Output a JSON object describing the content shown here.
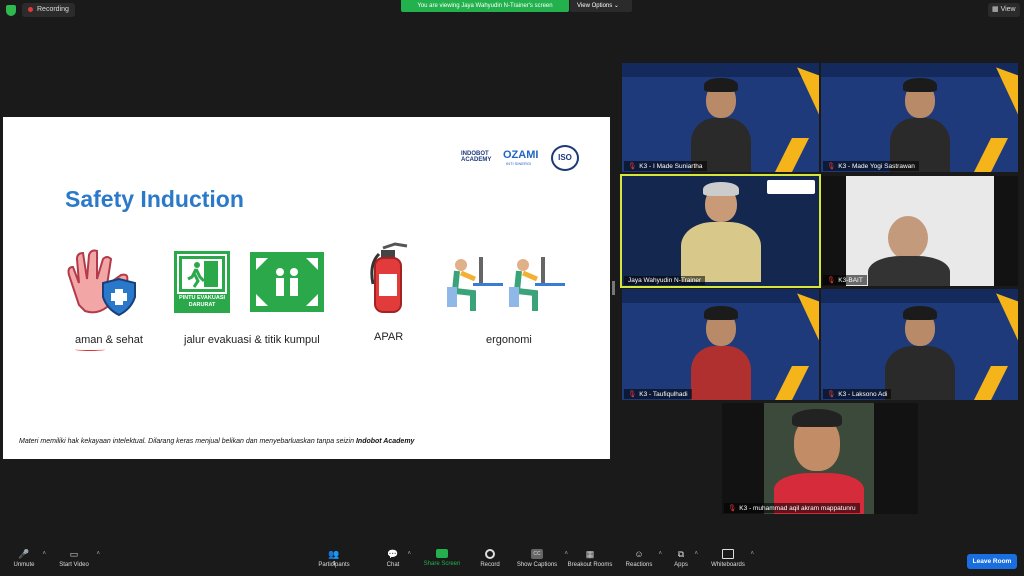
{
  "topbar": {
    "recording_label": "Recording",
    "viewing_text": "You are viewing Jaya Wahyudin N-Trainer's screen",
    "view_options_label": "View Options",
    "view_label": "View"
  },
  "slide": {
    "title": "Safety Induction",
    "logo_indobot": "INDOBOT ACADEMY",
    "logo_ozami": "OZAMI",
    "logo_inti": "INTI SINERGI",
    "logo_iso": "ISO",
    "labels": {
      "aman": "aman & sehat",
      "jalur": "jalur evakuasi & titik kumpul",
      "apar": "APAR",
      "ergonomi": "ergonomi"
    },
    "exit_sign_text": "PINTU EVAKUASI DARURAT",
    "footer_text": "Materi memiliki hak kekayaan intelektual. Dilarang keras menjual belikan dan menyebarluaskan tanpa seizin ",
    "footer_brand": "Indobot Academy"
  },
  "participants": [
    {
      "name": "K3 - I Made Suniartha"
    },
    {
      "name": "K3 - Made Yogi Sastrawan"
    },
    {
      "name": "Jaya Wahyudin N-Trainer"
    },
    {
      "name": "K3-BAIT"
    },
    {
      "name": "K3 - Taufiqulhadi"
    },
    {
      "name": "K3 - Laksono Adi"
    },
    {
      "name": "K3 - muhammad aqil akram mappatunru"
    }
  ],
  "toolbar": {
    "unmute": "Unmute",
    "start_video": "Start Video",
    "participants": "Participants",
    "participants_count": "8",
    "chat": "Chat",
    "share_screen": "Share Screen",
    "record": "Record",
    "show_captions": "Show Captions",
    "breakout_rooms": "Breakout Rooms",
    "reactions": "Reactions",
    "apps": "Apps",
    "whiteboards": "Whiteboards",
    "leave_room": "Leave Room"
  },
  "colors": {
    "accent_green": "#22b14c",
    "leave_blue": "#1a6fe0",
    "title_blue": "#2b79c9",
    "active_speaker": "#d6e63a"
  }
}
